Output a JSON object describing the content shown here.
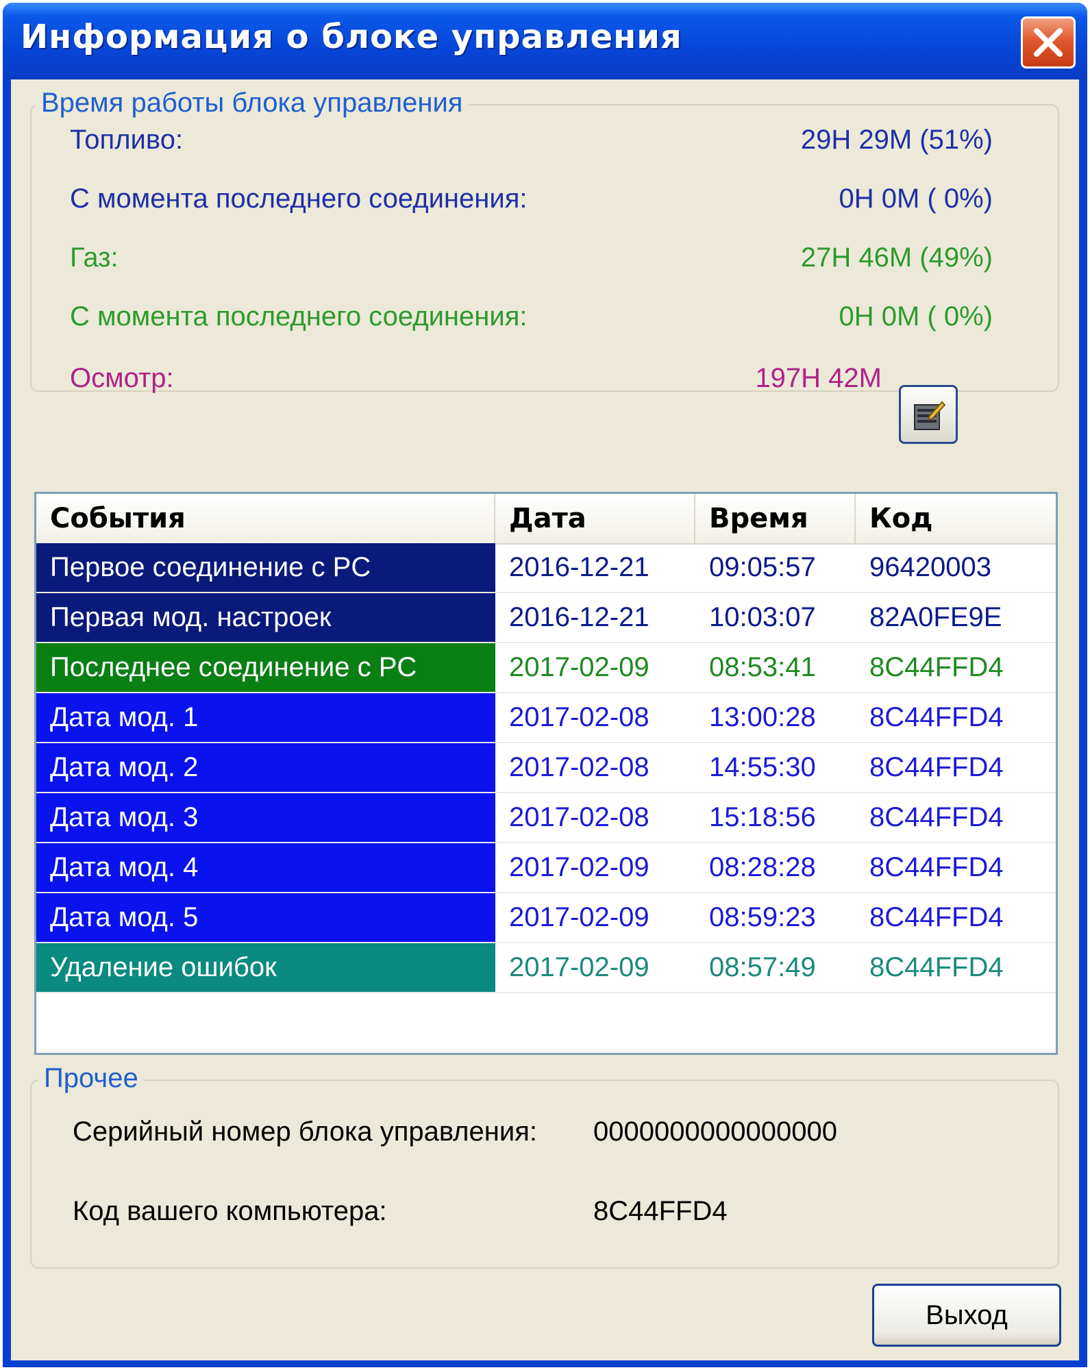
{
  "window": {
    "title": "Информация о блоке управления"
  },
  "uptime": {
    "legend": "Время работы блока управления",
    "fuel_label": "Топливо:",
    "fuel_value": "29H 29M (51%)",
    "fuel_since_label": "С момента последнего соединения:",
    "fuel_since_value": "0H  0M ( 0%)",
    "gas_label": "Газ:",
    "gas_value": "27H 46M (49%)",
    "gas_since_label": "С момента последнего соединения:",
    "gas_since_value": "0H  0M ( 0%)",
    "inspection_label": "Осмотр:",
    "inspection_value": "197H 42M",
    "edit_icon": "notepad-edit-icon"
  },
  "events_table": {
    "columns": [
      "События",
      "Дата",
      "Время",
      "Код"
    ],
    "rows": [
      {
        "event": "Первое соединение с PC",
        "date": "2016-12-21",
        "time": "09:05:57",
        "code": "96420003",
        "event_bg": "#0a1a7a",
        "text_color": "#0b1a8a"
      },
      {
        "event": "Первая мод. настроек",
        "date": "2016-12-21",
        "time": "10:03:07",
        "code": "82A0FE9E",
        "event_bg": "#0a1a7a",
        "text_color": "#0b1a8a"
      },
      {
        "event": "Последнее соединение с PC",
        "date": "2017-02-09",
        "time": "08:53:41",
        "code": "8C44FFD4",
        "event_bg": "#0a7f14",
        "text_color": "#1e8a1e"
      },
      {
        "event": "Дата мод. 1",
        "date": "2017-02-08",
        "time": "13:00:28",
        "code": "8C44FFD4",
        "event_bg": "#0a12ee",
        "text_color": "#1a1ad6"
      },
      {
        "event": "Дата мод. 2",
        "date": "2017-02-08",
        "time": "14:55:30",
        "code": "8C44FFD4",
        "event_bg": "#0a12ee",
        "text_color": "#1a1ad6"
      },
      {
        "event": "Дата мод. 3",
        "date": "2017-02-08",
        "time": "15:18:56",
        "code": "8C44FFD4",
        "event_bg": "#0a12ee",
        "text_color": "#1a1ad6"
      },
      {
        "event": "Дата мод. 4",
        "date": "2017-02-09",
        "time": "08:28:28",
        "code": "8C44FFD4",
        "event_bg": "#0a12ee",
        "text_color": "#1a1ad6"
      },
      {
        "event": "Дата мод. 5",
        "date": "2017-02-09",
        "time": "08:59:23",
        "code": "8C44FFD4",
        "event_bg": "#0a12ee",
        "text_color": "#1a1ad6"
      },
      {
        "event": "Удаление ошибок",
        "date": "2017-02-09",
        "time": "08:57:49",
        "code": "8C44FFD4",
        "event_bg": "#0a8a80",
        "text_color": "#1a8a7a"
      }
    ]
  },
  "other": {
    "legend": "Прочее",
    "serial_label": "Серийный номер блока управления:",
    "serial_value": "0000000000000000",
    "pc_code_label": "Код вашего компьютера:",
    "pc_code_value": "8C44FFD4"
  },
  "buttons": {
    "exit_label": "Выход"
  },
  "colors": {
    "fuel": "#1f2fa8",
    "gas": "#2e9a2e",
    "inspection": "#b0208a",
    "legend": "#1f5fcf",
    "dialog_bg": "#ece9d8",
    "titlebar": "#0646d8"
  }
}
